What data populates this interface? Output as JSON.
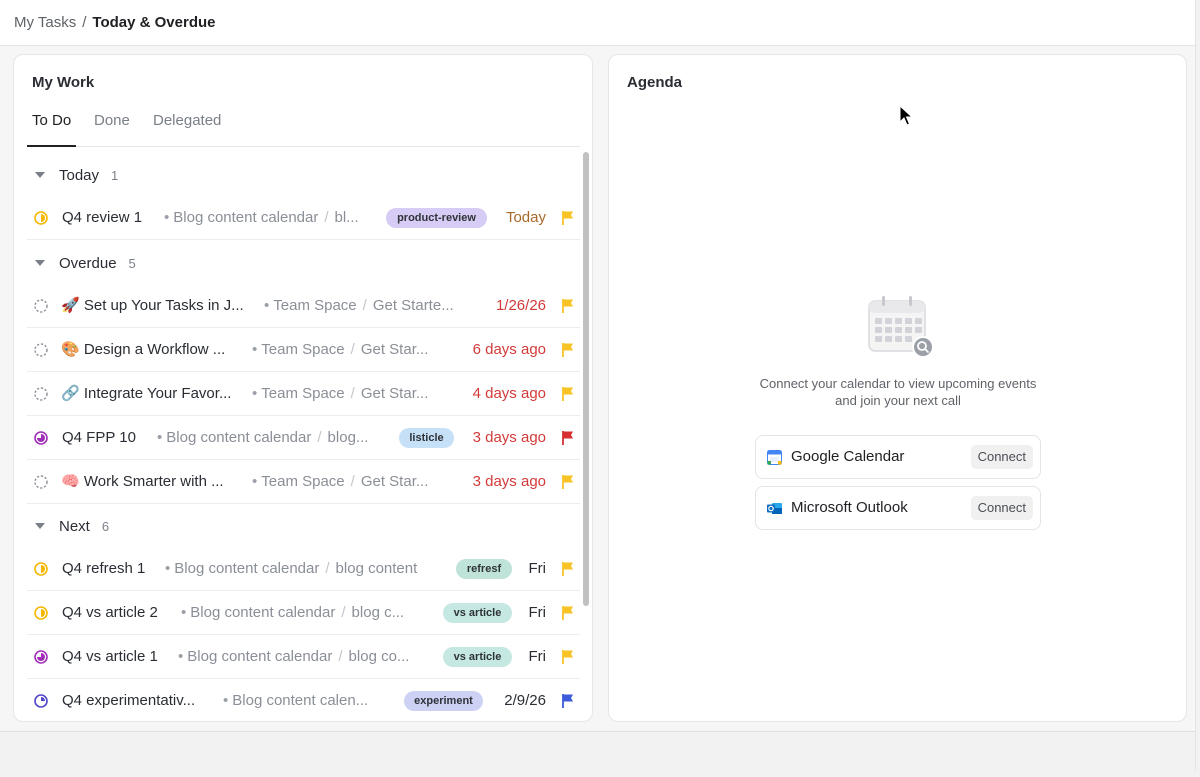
{
  "breadcrumb": {
    "parent": "My Tasks",
    "separator": "/",
    "current": "Today & Overdue"
  },
  "my_work": {
    "title": "My Work",
    "tabs": [
      "To Do",
      "Done",
      "Delegated"
    ],
    "active_tab": "To Do",
    "groups": [
      {
        "name": "Today",
        "count": "1"
      },
      {
        "name": "Overdue",
        "count": "5"
      },
      {
        "name": "Next",
        "count": "6"
      }
    ],
    "tasks": [
      {
        "name": "Q4 review 1",
        "dot": "•",
        "loc1": "Blog content calendar",
        "sep": "/",
        "loc2": "bl...",
        "tag": "product-review",
        "due": "Today",
        "status_icon": "half-circle-yellow-icon",
        "flag": "yellow"
      },
      {
        "name": "🚀 Set up Your Tasks in J...",
        "dot": "•",
        "loc1": "Team Space",
        "sep": "/",
        "loc2": "Get Starte...",
        "tag": "",
        "due": "1/26/26",
        "status_icon": "dashed-circle-icon",
        "flag": "yellow"
      },
      {
        "name": "🎨 Design a Workflow ...",
        "dot": "•",
        "loc1": "Team Space",
        "sep": "/",
        "loc2": "Get Star...",
        "tag": "",
        "due": "6 days ago",
        "status_icon": "dashed-circle-icon",
        "flag": "yellow"
      },
      {
        "name": "🔗 Integrate Your Favor...",
        "dot": "•",
        "loc1": "Team Space",
        "sep": "/",
        "loc2": "Get Star...",
        "tag": "",
        "due": "4 days ago",
        "status_icon": "dashed-circle-icon",
        "flag": "yellow"
      },
      {
        "name": "Q4 FPP 10",
        "dot": "•",
        "loc1": "Blog content calendar",
        "sep": "/",
        "loc2": "blog...",
        "tag": "listicle",
        "due": "3 days ago",
        "status_icon": "three-quarter-circle-purple-icon",
        "flag": "red"
      },
      {
        "name": "🧠 Work Smarter with ...",
        "dot": "•",
        "loc1": "Team Space",
        "sep": "/",
        "loc2": "Get Star...",
        "tag": "",
        "due": "3 days ago",
        "status_icon": "dashed-circle-icon",
        "flag": "yellow"
      },
      {
        "name": "Q4 refresh 1",
        "dot": "•",
        "loc1": "Blog content calendar",
        "sep": "/",
        "loc2": "blog content",
        "tag": "refresf",
        "due": "Fri",
        "status_icon": "half-circle-yellow-icon",
        "flag": "yellow"
      },
      {
        "name": "Q4 vs article 2",
        "dot": "•",
        "loc1": "Blog content calendar",
        "sep": "/",
        "loc2": "blog c...",
        "tag": "vs article",
        "due": "Fri",
        "status_icon": "half-circle-yellow-icon",
        "flag": "yellow"
      },
      {
        "name": "Q4 vs article 1",
        "dot": "•",
        "loc1": "Blog content calendar",
        "sep": "/",
        "loc2": "blog co...",
        "tag": "vs article",
        "due": "Fri",
        "status_icon": "three-quarter-circle-purple-icon",
        "flag": "yellow"
      },
      {
        "name": "Q4 experimentativ...",
        "dot": "•",
        "loc1": "Blog content calen...",
        "sep": "",
        "loc2": "",
        "tag": "experiment",
        "due": "2/9/26",
        "status_icon": "quarter-circle-blue-icon",
        "flag": "blue"
      }
    ]
  },
  "agenda": {
    "title": "Agenda",
    "empty_message": "Connect your calendar to view upcoming events and join your next call",
    "providers": [
      {
        "name": "Google Calendar",
        "button": "Connect",
        "icon": "google-calendar-icon"
      },
      {
        "name": "Microsoft Outlook",
        "button": "Connect",
        "icon": "outlook-icon"
      }
    ]
  },
  "colors": {
    "tag_product_review": "#d6ccf5",
    "tag_listicle": "#c6e0f8",
    "tag_refresf": "#bfe3d9",
    "tag_vs_article": "#c5e8e2",
    "tag_experiment": "#cdd2f5",
    "due_overdue": "#d23a3a",
    "due_today": "#a86a2a",
    "flag_yellow": "#f7c325",
    "flag_red": "#d72f2f",
    "flag_blue": "#3b5bdb"
  }
}
